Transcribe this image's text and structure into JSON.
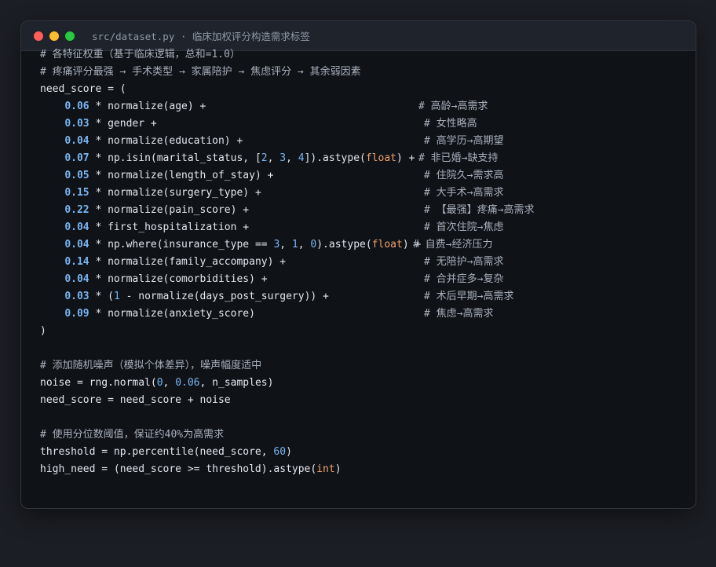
{
  "window": {
    "title": "src/dataset.py · 临床加权评分构造需求标签",
    "controls": {
      "close_color": "#ff5f57",
      "minimize_color": "#febc2e",
      "maximize_color": "#28c840"
    }
  },
  "code": {
    "comment_weights_1": "# 各特征权重（基于临床逻辑，总和=1.0）",
    "comment_weights_2": "# 疼痛评分最强 → 手术类型 → 家属陪护 → 焦虑评分 → 其余弱因素",
    "need_score_open": "need_score = (",
    "terms": [
      {
        "weight": "0.06",
        "expr": " * normalize(age) +",
        "comment": "# 高龄→高需求"
      },
      {
        "weight": "0.03",
        "expr": " * gender +",
        "comment": "# 女性略高"
      },
      {
        "weight": "0.04",
        "expr": " * normalize(education) +",
        "comment": "# 高学历→高期望"
      },
      {
        "weight": "0.07",
        "expr_a": " * np.isin(marital_status, [",
        "n1": "2",
        "sep1": ", ",
        "n2": "3",
        "sep2": ", ",
        "n3": "4",
        "expr_b": "]).astype(",
        "kw": "float",
        "expr_c": ") +",
        "comment": "# 非已婚→缺支持"
      },
      {
        "weight": "0.05",
        "expr": " * normalize(length_of_stay) +",
        "comment": "# 住院久→需求高"
      },
      {
        "weight": "0.15",
        "expr": " * normalize(surgery_type) +",
        "comment": "# 大手术→高需求"
      },
      {
        "weight": "0.22",
        "expr": " * normalize(pain_score) +",
        "comment": "# 【最强】疼痛→高需求"
      },
      {
        "weight": "0.04",
        "expr": " * first_hospitalization +",
        "comment": "# 首次住院→焦虑"
      },
      {
        "weight": "0.04",
        "expr_a": " * np.where(insurance_type == ",
        "n1": "3",
        "sep1": ", ",
        "n2": "1",
        "sep2": ", ",
        "n3": "0",
        "expr_b": ").astype(",
        "kw": "float",
        "expr_c": ") +",
        "comment": "# 自费→经济压力"
      },
      {
        "weight": "0.14",
        "expr": " * normalize(family_accompany) +",
        "comment": "# 无陪护→高需求"
      },
      {
        "weight": "0.04",
        "expr": " * normalize(comorbidities) +",
        "comment": "# 合并症多→复杂"
      },
      {
        "weight": "0.03",
        "expr_a": " * (",
        "n1": "1",
        "expr_b": " - normalize(days_post_surgery)) +",
        "comment": "# 术后早期→高需求"
      },
      {
        "weight": "0.09",
        "expr": " * normalize(anxiety_score)",
        "comment": "# 焦虑→高需求"
      }
    ],
    "need_score_close": ")",
    "comment_noise": "# 添加随机噪声（模拟个体差异），噪声幅度适中",
    "noise_a": "noise = rng.normal(",
    "noise_n1": "0",
    "noise_sep": ", ",
    "noise_n2": "0.06",
    "noise_b": ", n_samples)",
    "need_score_update": "need_score = need_score + noise",
    "comment_threshold": "# 使用分位数阈值，保证约40%为高需求",
    "threshold_a": "threshold = np.percentile(need_score, ",
    "threshold_n": "60",
    "threshold_b": ")",
    "high_need_a": "high_need = (need_score >= threshold).astype(",
    "high_need_kw": "int",
    "high_need_b": ")"
  }
}
